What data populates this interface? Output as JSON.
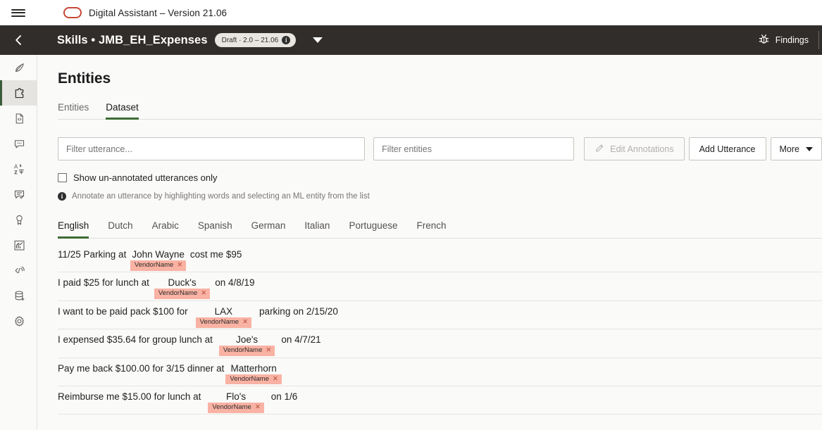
{
  "topbar": {
    "menu_icon": "hamburger-icon",
    "logo_icon": "oracle-logo",
    "title": "Digital Assistant – Version 21.06"
  },
  "header": {
    "back_icon": "chevron-left-icon",
    "title": "Skills • JMB_EH_Expenses",
    "badge": "Draft · 2.0 – 21.06",
    "badge_info_icon": "info-icon",
    "caret_icon": "chevron-down-icon",
    "findings_label": "Findings",
    "findings_icon": "bug-icon"
  },
  "sidebar": {
    "items": [
      {
        "name": "sidebar-item-intents",
        "icon": "feather-icon",
        "active": false
      },
      {
        "name": "sidebar-item-entities",
        "icon": "puzzle-piece-icon",
        "active": true
      },
      {
        "name": "sidebar-item-resource-bundles",
        "icon": "document-code-icon",
        "active": false
      },
      {
        "name": "sidebar-item-dialog",
        "icon": "chat-bubble-icon",
        "active": false
      },
      {
        "name": "sidebar-item-translation",
        "icon": "translate-icon",
        "active": false
      },
      {
        "name": "sidebar-item-qna",
        "icon": "chat-check-icon",
        "active": false
      },
      {
        "name": "sidebar-item-quality",
        "icon": "badge-icon",
        "active": false
      },
      {
        "name": "sidebar-item-insights",
        "icon": "chart-icon",
        "active": false
      },
      {
        "name": "sidebar-item-api",
        "icon": "code-broadcast-icon",
        "active": false
      },
      {
        "name": "sidebar-item-datastore",
        "icon": "database-add-icon",
        "active": false
      },
      {
        "name": "sidebar-item-settings",
        "icon": "gear-icon",
        "active": false
      }
    ]
  },
  "main": {
    "page_title": "Entities",
    "tabs": [
      {
        "label": "Entities",
        "active": false
      },
      {
        "label": "Dataset",
        "active": true
      }
    ],
    "filters": {
      "utterance_placeholder": "Filter utterance...",
      "utterance_value": "",
      "entities_placeholder": "Filter entities",
      "entities_value": ""
    },
    "buttons": {
      "edit_annotations": "Edit Annotations",
      "edit_annotations_icon": "pencil-icon",
      "edit_annotations_disabled": true,
      "add_utterance": "Add Utterance",
      "more": "More",
      "more_caret_icon": "chevron-down-icon"
    },
    "checkbox": {
      "label": "Show un-annotated utterances only",
      "checked": false
    },
    "hint": {
      "icon": "info-icon",
      "text": "Annotate an utterance by highlighting words and selecting an ML entity from the list"
    },
    "languages": [
      {
        "label": "English",
        "active": true
      },
      {
        "label": "Dutch",
        "active": false
      },
      {
        "label": "Arabic",
        "active": false
      },
      {
        "label": "Spanish",
        "active": false
      },
      {
        "label": "German",
        "active": false
      },
      {
        "label": "Italian",
        "active": false
      },
      {
        "label": "Portuguese",
        "active": false
      },
      {
        "label": "French",
        "active": false
      }
    ],
    "utterances": [
      {
        "prefix": "11/25 Parking at",
        "entity": "John Wayne",
        "suffix": "cost me $95",
        "tag": "VendorName",
        "tag_remove_icon": "close-icon",
        "entity_pad": 0
      },
      {
        "prefix": "I paid $25 for lunch at",
        "entity": "Duck's",
        "suffix": "on 4/8/19",
        "tag": "VendorName",
        "tag_remove_icon": "close-icon",
        "entity_pad": 14
      },
      {
        "prefix": "I want to be paid pack $100 for",
        "entity": "LAX",
        "suffix": "parking on 2/15/20",
        "tag": "VendorName",
        "tag_remove_icon": "close-icon",
        "entity_pad": 22
      },
      {
        "prefix": "I expensed $35.64 for group lunch at",
        "entity": "Joe's",
        "suffix": "on 4/7/21",
        "tag": "VendorName",
        "tag_remove_icon": "close-icon",
        "entity_pad": 18
      },
      {
        "prefix": "Pay me back $100.00 for 3/15 dinner at",
        "entity": "Matterhorn",
        "suffix": "",
        "tag": "VendorName",
        "tag_remove_icon": "close-icon",
        "entity_pad": 0
      },
      {
        "prefix": "Reimburse me $15.00 for lunch at",
        "entity": "Flo's",
        "suffix": "on 1/6",
        "tag": "VendorName",
        "tag_remove_icon": "close-icon",
        "entity_pad": 20
      }
    ]
  },
  "colors": {
    "header_bg": "#312d2a",
    "accent_green": "#3e6b35",
    "oracle_red": "#c74634",
    "tag_bg": "#f9b2a3",
    "page_bg": "#fafaf9"
  }
}
